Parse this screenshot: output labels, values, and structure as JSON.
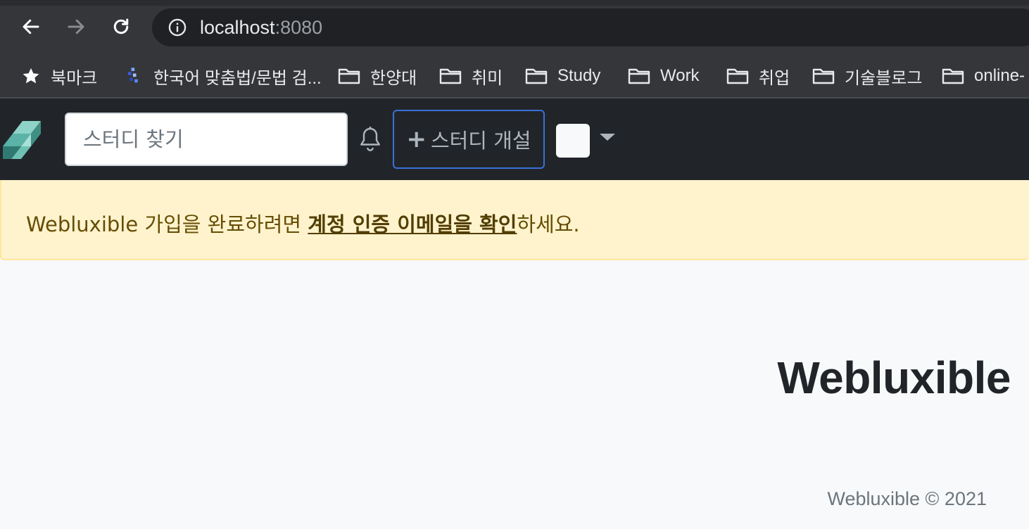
{
  "browser": {
    "url_host": "localhost",
    "url_port": ":8080",
    "bookmarks": [
      {
        "label": "북마크",
        "icon": "star-icon"
      },
      {
        "label": "한국어 맞춤법/문법 검...",
        "icon": "spellcheck-icon"
      },
      {
        "label": "한양대",
        "icon": "folder-icon"
      },
      {
        "label": "취미",
        "icon": "folder-icon"
      },
      {
        "label": "Study",
        "icon": "folder-icon"
      },
      {
        "label": "Work",
        "icon": "folder-icon"
      },
      {
        "label": "취업",
        "icon": "folder-icon"
      },
      {
        "label": "기술블로그",
        "icon": "folder-icon"
      },
      {
        "label": "online-",
        "icon": "folder-icon"
      }
    ]
  },
  "navbar": {
    "search_placeholder": "스터디 찾기",
    "create_label": "스터디 개설",
    "create_icon": "plus-icon"
  },
  "alert": {
    "prefix": "Webluxible 가입을 완료하려면 ",
    "link": "계정 인증 이메일을 확인",
    "suffix": "하세요."
  },
  "main": {
    "title": "Webluxible"
  },
  "footer": {
    "text": "Webluxible © 2021"
  },
  "colors": {
    "navbar_bg": "#212529",
    "alert_bg": "#fff3cd",
    "alert_text": "#664d03",
    "accent_border": "#3a6fd8"
  }
}
